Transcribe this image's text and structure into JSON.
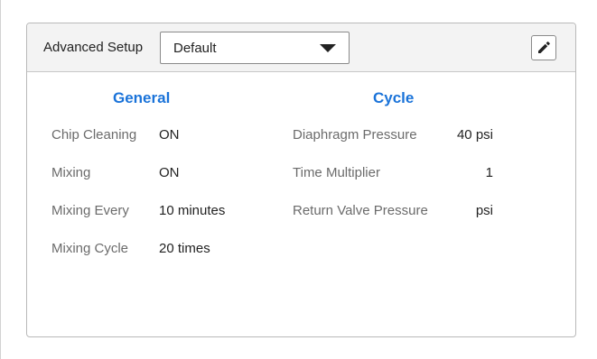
{
  "header": {
    "setup_label": "Advanced Setup",
    "preset_value": "Default",
    "edit_icon": "pencil-icon"
  },
  "general": {
    "title": "General",
    "rows": [
      {
        "label": "Chip Cleaning",
        "value": "ON"
      },
      {
        "label": "Mixing",
        "value": "ON"
      },
      {
        "label": "Mixing Every",
        "value": "10 minutes"
      },
      {
        "label": "Mixing Cycle",
        "value": "20 times"
      }
    ]
  },
  "cycle": {
    "title": "Cycle",
    "rows": [
      {
        "label": "Diaphragm Pressure",
        "value": "40 psi"
      },
      {
        "label": "Time Multiplier",
        "value": "1"
      },
      {
        "label": "Return Valve Pressure",
        "value": "psi"
      }
    ]
  },
  "colors": {
    "accent": "#1a73d9",
    "header_bg": "#f3f3f3",
    "label_text": "#6b6b6b",
    "value_text": "#222222"
  }
}
